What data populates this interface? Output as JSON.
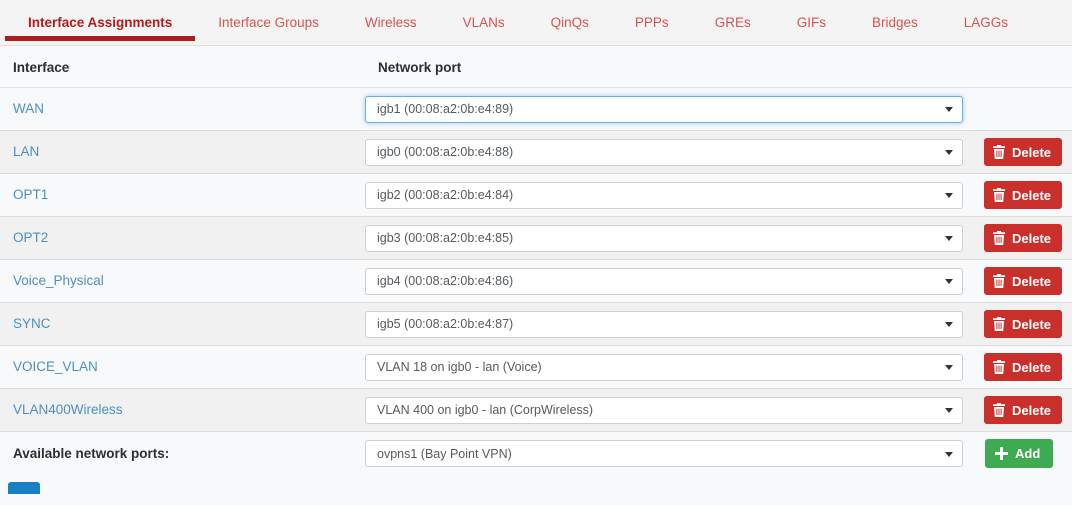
{
  "tabs": [
    {
      "label": "Interface Assignments",
      "active": true
    },
    {
      "label": "Interface Groups",
      "active": false
    },
    {
      "label": "Wireless",
      "active": false
    },
    {
      "label": "VLANs",
      "active": false
    },
    {
      "label": "QinQs",
      "active": false
    },
    {
      "label": "PPPs",
      "active": false
    },
    {
      "label": "GREs",
      "active": false
    },
    {
      "label": "GIFs",
      "active": false
    },
    {
      "label": "Bridges",
      "active": false
    },
    {
      "label": "LAGGs",
      "active": false
    }
  ],
  "table": {
    "headers": {
      "interface": "Interface",
      "network_port": "Network port"
    },
    "rows": [
      {
        "interface": "WAN",
        "port": "igb1 (00:08:a2:0b:e4:89)",
        "focused": true,
        "delete": false
      },
      {
        "interface": "LAN",
        "port": "igb0 (00:08:a2:0b:e4:88)",
        "focused": false,
        "delete": true
      },
      {
        "interface": "OPT1",
        "port": "igb2 (00:08:a2:0b:e4:84)",
        "focused": false,
        "delete": true
      },
      {
        "interface": "OPT2",
        "port": "igb3 (00:08:a2:0b:e4:85)",
        "focused": false,
        "delete": true
      },
      {
        "interface": "Voice_Physical",
        "port": "igb4 (00:08:a2:0b:e4:86)",
        "focused": false,
        "delete": true
      },
      {
        "interface": "SYNC",
        "port": "igb5 (00:08:a2:0b:e4:87)",
        "focused": false,
        "delete": true
      },
      {
        "interface": "VOICE_VLAN",
        "port": "VLAN 18 on igb0 - lan (Voice)",
        "focused": false,
        "delete": true
      },
      {
        "interface": "VLAN400Wireless",
        "port": "VLAN 400 on igb0 - lan (CorpWireless)",
        "focused": false,
        "delete": true
      }
    ]
  },
  "available": {
    "label": "Available network ports:",
    "port": "ovpns1 (Bay Point VPN)",
    "add_label": "Add"
  },
  "buttons": {
    "delete_label": "Delete",
    "save_label": ""
  },
  "colors": {
    "tab_active": "#b01b1b",
    "tab_link": "#d9534f",
    "delete_red": "#c9302c",
    "add_green": "#3eab52",
    "save_blue": "#1b7dc4",
    "interface_link": "#4f8fc0"
  }
}
